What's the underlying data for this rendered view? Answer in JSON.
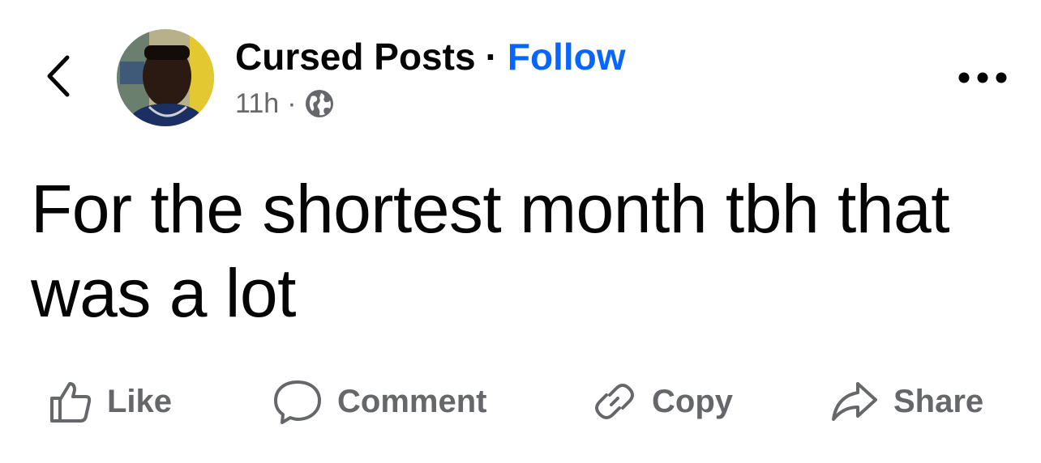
{
  "header": {
    "author_name": "Cursed Posts",
    "separator": "·",
    "follow_label": "Follow",
    "timestamp": "11h",
    "meta_separator": "·",
    "audience_icon": "globe-icon",
    "back_icon": "chevron-left-icon",
    "more_icon": "more-horizontal-icon"
  },
  "post": {
    "text": "For the shortest month tbh that was a lot"
  },
  "actions": [
    {
      "label": "Like",
      "icon": "thumbs-up-icon"
    },
    {
      "label": "Comment",
      "icon": "comment-icon"
    },
    {
      "label": "Copy",
      "icon": "link-icon"
    },
    {
      "label": "Share",
      "icon": "share-icon"
    }
  ],
  "colors": {
    "accent": "#0866ff",
    "text_primary": "#050505",
    "text_secondary": "#65676b"
  }
}
